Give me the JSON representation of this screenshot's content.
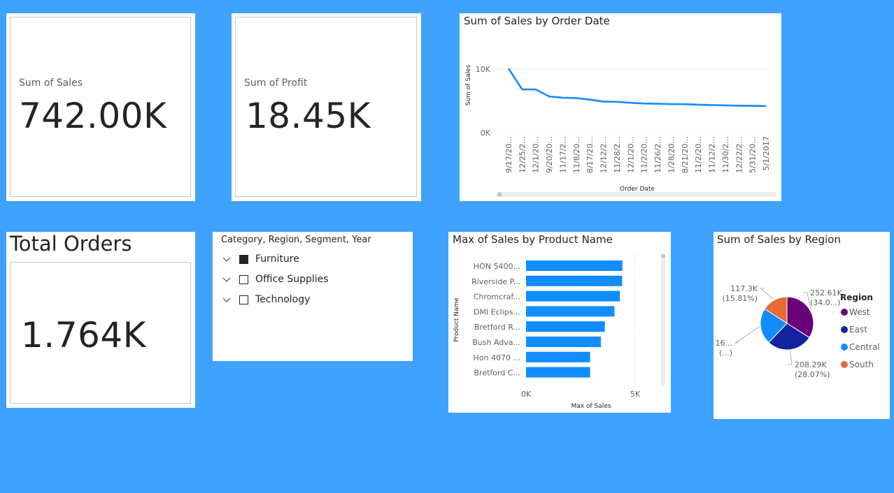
{
  "colors": {
    "background": "#40A2FF",
    "line": "#118DFF",
    "bar": "#118DFF",
    "west": "#6B007B",
    "east": "#12239E",
    "central": "#118DFF",
    "south": "#E66C37"
  },
  "cards": {
    "sales": {
      "label": "Sum of Sales",
      "value": "742.00K"
    },
    "profit": {
      "label": "Sum of Profit",
      "value": "18.45K"
    },
    "orders": {
      "title": "Total Orders",
      "value": "1.764K"
    }
  },
  "slicer": {
    "header": "Category, Region, Segment, Year",
    "items": [
      {
        "label": "Furniture",
        "checked": true
      },
      {
        "label": "Office Supplies",
        "checked": false
      },
      {
        "label": "Technology",
        "checked": false
      }
    ]
  },
  "line_chart": {
    "title": "Sum of Sales by Order Date",
    "chart_data": {
      "type": "line",
      "title": "Sum of Sales by Order Date",
      "xlabel": "Order Date",
      "ylabel": "Sum of Sales",
      "ylim": [
        0,
        10000
      ],
      "yticks": [
        "0K",
        "10K"
      ],
      "grid": true,
      "categories": [
        "9/17/20...",
        "12/25/2...",
        "12/1/20...",
        "9/20/20...",
        "11/17/2...",
        "11/8/20...",
        "8/17/20...",
        "12/12/2...",
        "11/28/2...",
        "12/1/20...",
        "11/2/20...",
        "11/26/2...",
        "1/28/20...",
        "8/21/20...",
        "11/2/20...",
        "11/12/2...",
        "11/30/2...",
        "12/22/2...",
        "5/31/20...",
        "5/1/2017"
      ],
      "values": [
        10100,
        6800,
        6800,
        5700,
        5500,
        5450,
        5200,
        4900,
        4850,
        4700,
        4600,
        4550,
        4500,
        4480,
        4400,
        4350,
        4300,
        4250,
        4220,
        4200
      ]
    }
  },
  "bar_chart": {
    "title": "Max of Sales by Product Name",
    "chart_data": {
      "type": "bar",
      "title": "Max of Sales by Product Name",
      "xlabel": "Max of Sales",
      "ylabel": "Product Name",
      "xlim": [
        0,
        5000
      ],
      "xticks": [
        "0K",
        "5K"
      ],
      "categories": [
        "HON 5400...",
        "Riverside P...",
        "Chromcraf...",
        "DMI Eclips...",
        "Bretford R...",
        "Bush Adva...",
        "Hon 4070 ...",
        "Bretford C..."
      ],
      "values": [
        4416,
        4404,
        4298,
        4049,
        3610,
        3430,
        2935,
        2935
      ]
    }
  },
  "pie_chart": {
    "title": "Sum of Sales by Region",
    "legend_title": "Region",
    "chart_data": {
      "type": "pie",
      "title": "Sum of Sales by Region",
      "legend_position": "right",
      "categories": [
        "West",
        "East",
        "Central",
        "South"
      ],
      "values": [
        252.61,
        208.29,
        163.8,
        117.3
      ],
      "labels": [
        {
          "value": "252.61K",
          "pct": "(34.0...)"
        },
        {
          "value": "208.29K",
          "pct": "(28.07%)"
        },
        {
          "value": "16...",
          "pct": "(...)"
        },
        {
          "value": "117.3K",
          "pct": "(15.81%)"
        }
      ]
    }
  }
}
